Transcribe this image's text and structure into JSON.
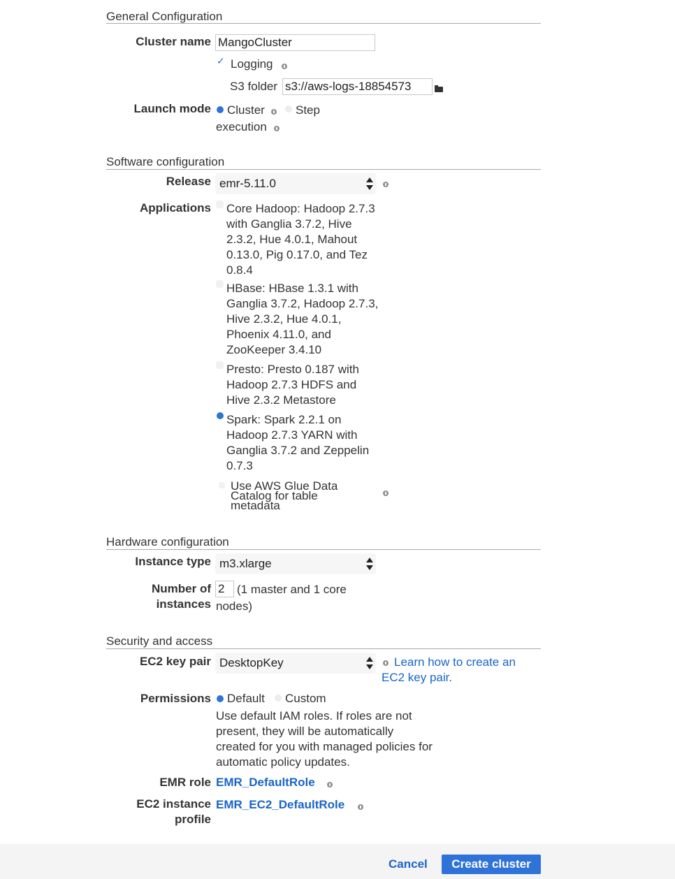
{
  "general": {
    "title": "General Configuration",
    "cluster_name_label": "Cluster name",
    "cluster_name_value": "MangoCluster",
    "logging_label": "Logging",
    "s3_folder_label": "S3 folder",
    "s3_folder_value": "s3://aws-logs-18854573",
    "launch_mode_label": "Launch mode",
    "launch_mode_cluster": "Cluster",
    "launch_mode_step": "Step",
    "launch_mode_step_cont": "execution"
  },
  "software": {
    "title": "Software configuration",
    "release_label": "Release",
    "release_value": "emr-5.11.0",
    "applications_label": "Applications",
    "app_core_hadoop": "Core Hadoop: Hadoop 2.7.3 with Ganglia 3.7.2, Hive 2.3.2, Hue 4.0.1, Mahout 0.13.0, Pig 0.17.0, and Tez 0.8.4",
    "app_hbase": "HBase: HBase 1.3.1 with Ganglia 3.7.2, Hadoop 2.7.3, Hive 2.3.2, Hue 4.0.1, Phoenix 4.11.0, and ZooKeeper 3.4.10",
    "app_presto": "Presto: Presto 0.187 with Hadoop 2.7.3 HDFS and Hive 2.3.2 Metastore",
    "app_spark": "Spark: Spark 2.2.1 on Hadoop 2.7.3 YARN with Ganglia 3.7.2 and Zeppelin 0.7.3",
    "glue_label": "Use AWS Glue Data Catalog for table metadata"
  },
  "hardware": {
    "title": "Hardware configuration",
    "instance_type_label": "Instance type",
    "instance_type_value": "m3.xlarge",
    "num_instances_label_1": "Number of",
    "num_instances_label_2": "instances",
    "num_instances_value": "2",
    "num_instances_note_1": "(1 master and 1 core",
    "num_instances_note_2": "nodes)"
  },
  "security": {
    "title": "Security and access",
    "key_pair_label": "EC2 key pair",
    "key_pair_value": "DesktopKey",
    "key_pair_link_1": "Learn how to create an",
    "key_pair_link_2": "EC2 key pair.",
    "permissions_label": "Permissions",
    "permissions_default": "Default",
    "permissions_custom": "Custom",
    "permissions_desc": "Use default IAM roles. If roles are not present, they will be automatically created for you with managed policies for automatic policy updates.",
    "emr_role_label": "EMR role",
    "emr_role_value": "EMR_DefaultRole",
    "ec2_profile_label_1": "EC2 instance",
    "ec2_profile_label_2": "profile",
    "ec2_profile_value": "EMR_EC2_DefaultRole"
  },
  "footer": {
    "cancel": "Cancel",
    "create": "Create cluster"
  },
  "colors": {
    "accent": "#2f73d8",
    "link": "#1a65c7"
  },
  "state": {
    "logging_checked": true,
    "launch_mode": "Cluster",
    "selected_application": "Spark",
    "glue_checked": false,
    "permissions": "Default"
  }
}
